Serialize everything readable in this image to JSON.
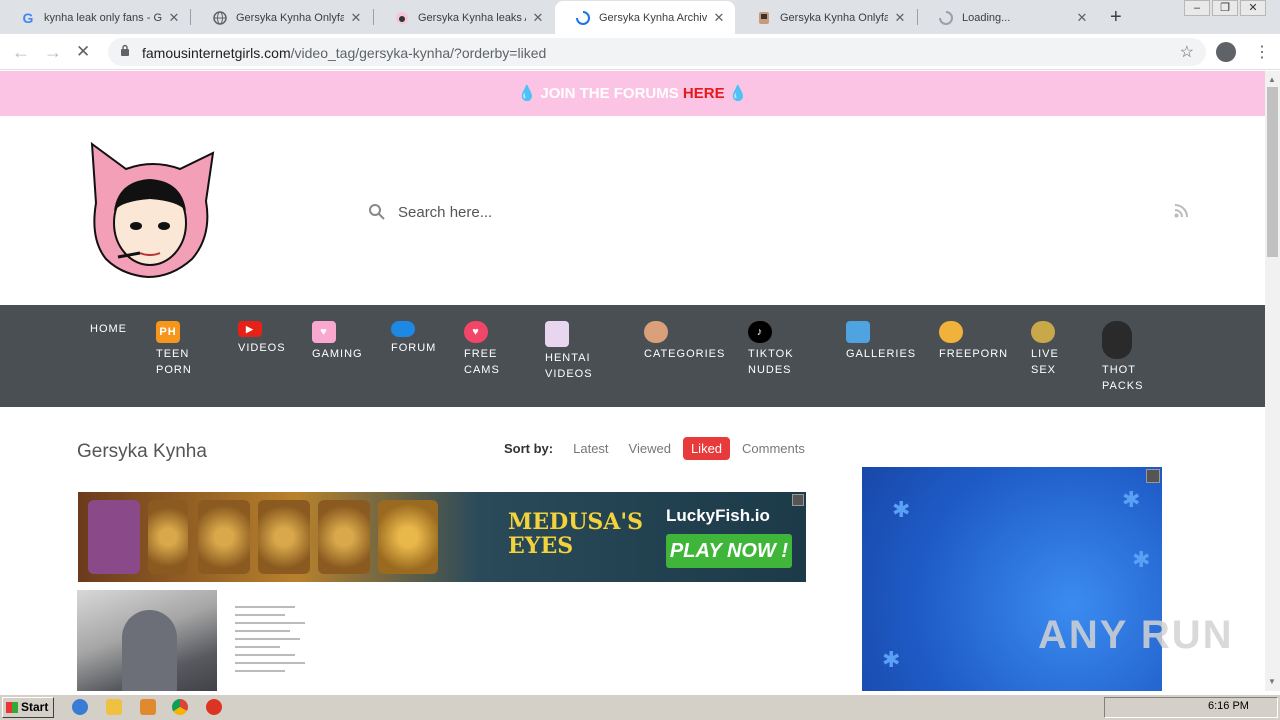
{
  "browser": {
    "tabs": [
      {
        "title": "kynha leak only fans - Go",
        "favicon": "google-icon"
      },
      {
        "title": "Gersyka Kynha Onlyfans",
        "favicon": "globe-icon"
      },
      {
        "title": "Gersyka Kynha leaks Arc",
        "favicon": "site-icon"
      },
      {
        "title": "Gersyka Kynha Archives",
        "favicon": "loading-icon",
        "active": true
      },
      {
        "title": "Gersyka Kynha Onlyfans",
        "favicon": "site-icon"
      },
      {
        "title": "Loading...",
        "favicon": "loading-icon"
      }
    ],
    "new_tab": "+",
    "url_domain": "famousinternetgirls.com",
    "url_path": "/video_tag/gersyka-kynha/?orderby=liked"
  },
  "site": {
    "forum_banner_prefix": "JOIN THE FORUMS",
    "forum_banner_link": "HERE",
    "search_placeholder": "Search here...",
    "nav": [
      {
        "label": "HOME",
        "icon": ""
      },
      {
        "label": "TEEN PORN",
        "icon": "ph-icon"
      },
      {
        "label": "VIDEOS",
        "icon": "youtube-icon"
      },
      {
        "label": "GAMING",
        "icon": "heart-chat-icon"
      },
      {
        "label": "FORUM",
        "icon": "chat-icon"
      },
      {
        "label": "FREE CAMS",
        "icon": "heart-icon"
      },
      {
        "label": "HENTAI VIDEOS",
        "icon": "anime-icon"
      },
      {
        "label": "CATEGORIES",
        "icon": "avatar-icon"
      },
      {
        "label": "TIKTOK NUDES",
        "icon": "tiktok-icon"
      },
      {
        "label": "GALLERIES",
        "icon": "gallery-icon"
      },
      {
        "label": "FREEPORN",
        "icon": "face-icon"
      },
      {
        "label": "LIVE SEX",
        "icon": "webcam-icon"
      },
      {
        "label": "THOT PACKS",
        "icon": "girl-icon"
      }
    ],
    "page_title": "Gersyka Kynha",
    "sort_label": "Sort by:",
    "sort_options": [
      "Latest",
      "Viewed",
      "Liked",
      "Comments"
    ],
    "sort_active": "Liked",
    "banner": {
      "headline": "MEDUSA'S EYES",
      "brand": "LuckyFish.io",
      "cta": "PLAY NOW !"
    }
  },
  "watermark": "ANY RUN",
  "taskbar": {
    "start": "Start",
    "time": "6:16 PM"
  }
}
